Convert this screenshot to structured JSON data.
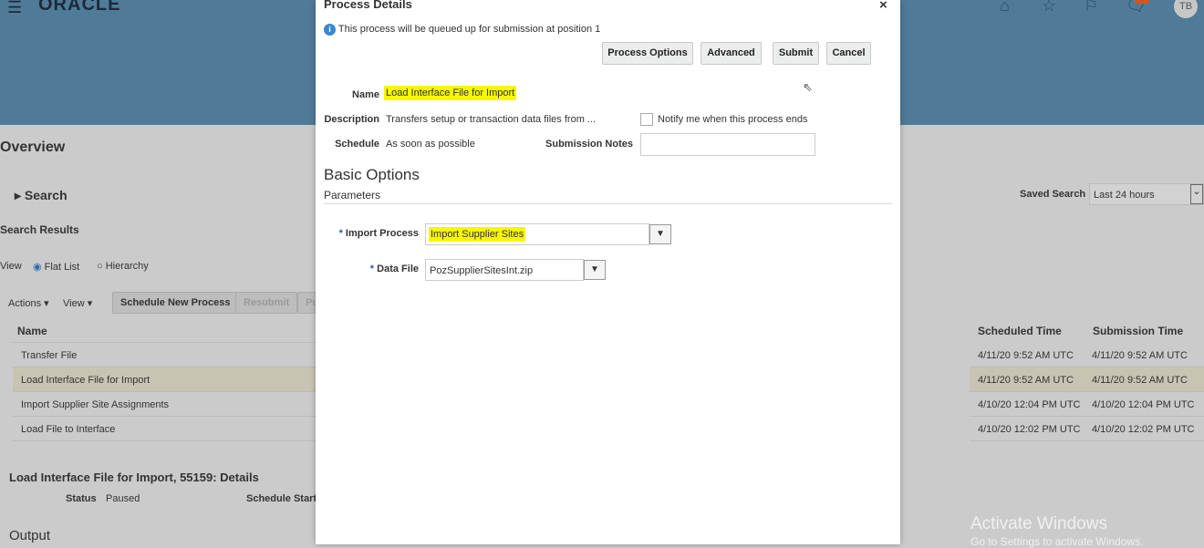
{
  "header": {
    "brand": "ORACLE",
    "avatar": "TB",
    "icons": [
      "menu-icon",
      "home-icon",
      "star-icon",
      "flag-icon",
      "notification-icon"
    ]
  },
  "background": {
    "overview": "Overview",
    "search": "Search",
    "search_results": "Search Results",
    "view_label": "View",
    "flat_list": "Flat List",
    "hierarchy": "Hierarchy",
    "actions": "Actions",
    "view_menu": "View",
    "schedule_new": "Schedule New Process",
    "resubmit": "Resubmit",
    "put": "Pu",
    "saved_search_label": "Saved Search",
    "saved_search_value": "Last 24 hours",
    "columns": {
      "name": "Name",
      "scheduled": "Scheduled Time",
      "submission": "Submission Time"
    },
    "rows": [
      {
        "name": "Transfer File",
        "scheduled": "4/11/20 9:52 AM UTC",
        "submission": "4/11/20 9:52 AM UTC"
      },
      {
        "name": "Load Interface File for Import",
        "scheduled": "4/11/20 9:52 AM UTC",
        "submission": "4/11/20 9:52 AM UTC"
      },
      {
        "name": "Import Supplier Site Assignments",
        "scheduled": "4/10/20 12:04 PM UTC",
        "submission": "4/10/20 12:04 PM UTC"
      },
      {
        "name": "Load File to Interface",
        "scheduled": "4/10/20 12:02 PM UTC",
        "submission": "4/10/20 12:02 PM UTC"
      }
    ],
    "details_title": "Load Interface File for Import, 55159: Details",
    "status_label": "Status",
    "status_value": "Paused",
    "schedule_start": "Schedule Start",
    "output": "Output"
  },
  "dialog": {
    "title": "Process Details",
    "close": "×",
    "info": "This process will be queued up for submission at position 1",
    "buttons": {
      "process_options": "Process Options",
      "advanced": "Advanced",
      "submit": "Submit",
      "cancel": "Cancel"
    },
    "name_label": "Name",
    "name_value": "Load Interface File for Import",
    "description_label": "Description",
    "description_value": "Transfers setup or transaction data files from ...",
    "schedule_label": "Schedule",
    "schedule_value": "As soon as possible",
    "notify_label": "Notify me when this process ends",
    "notify_checked": false,
    "notes_label": "Submission Notes",
    "notes_value": "",
    "basic_options": "Basic Options",
    "parameters": "Parameters",
    "import_process_label": "Import Process",
    "import_process_value": "Import Supplier Sites",
    "data_file_label": "Data File",
    "data_file_value": "PozSupplierSitesInt.zip",
    "required": "*"
  },
  "watermark": {
    "line1": "Activate Windows",
    "line2": "Go to Settings to activate Windows."
  },
  "colors": {
    "header": "#4f7b98",
    "highlight": "#f6f700"
  }
}
